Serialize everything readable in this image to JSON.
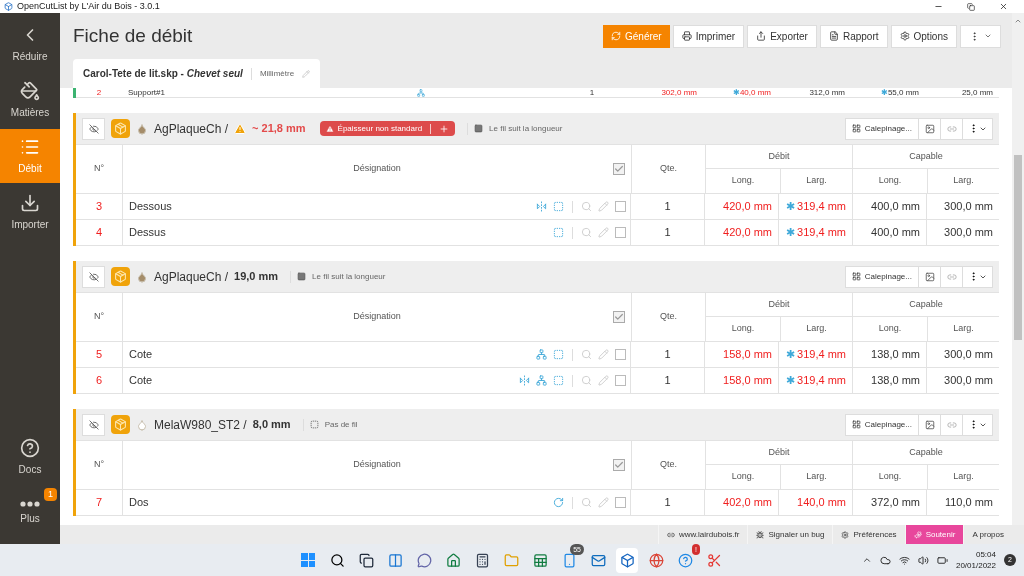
{
  "window": {
    "title": "OpenCutList by L'Air du Bois - 3.0.1"
  },
  "sidebar": {
    "items": [
      {
        "kind": "collapse",
        "label": "Réduire",
        "selected": false
      },
      {
        "kind": "materials",
        "label": "Matières",
        "selected": false
      },
      {
        "kind": "cutlist",
        "label": "Débit",
        "selected": true
      },
      {
        "kind": "import",
        "label": "Importer",
        "selected": false
      },
      {
        "kind": "docs",
        "label": "Docs",
        "selected": false
      },
      {
        "kind": "more",
        "label": "Plus",
        "selected": false,
        "badge": "1"
      }
    ]
  },
  "header": {
    "title": "Fiche de débit",
    "buttons": [
      {
        "kind": "generate",
        "label": "Générer",
        "primary": true
      },
      {
        "kind": "print",
        "label": "Imprimer",
        "primary": false
      },
      {
        "kind": "export",
        "label": "Exporter",
        "primary": false
      },
      {
        "kind": "report",
        "label": "Rapport",
        "primary": false
      },
      {
        "kind": "options",
        "label": "Options",
        "primary": false
      },
      {
        "kind": "menu",
        "primary": false
      }
    ]
  },
  "tab": {
    "file": "Carol-Tete de lit.skp - *Chevet seul*",
    "unit": "Millimètre"
  },
  "partial_row": {
    "color": "#3cb371",
    "number": "2",
    "name": "Support#1",
    "icons": [
      {
        "kind": "nodes"
      }
    ],
    "qty": "1",
    "cells": [
      {
        "text": "302,0 mm",
        "warn": true
      },
      {
        "mark": "✱",
        "text": "40,0 mm",
        "warn": true
      },
      {
        "text": "312,0 mm",
        "warn": false
      },
      {
        "mark": "✱",
        "text": "55,0 mm",
        "warn": false
      },
      {
        "text": "25,0 mm",
        "warn": false
      }
    ]
  },
  "groups": [
    {
      "color": "#f0a30a",
      "drop": {
        "color": "#a58d6a"
      },
      "material": "AgPlaqueCh /",
      "thickness": "~ 21,8 mm",
      "thickness_warning": true,
      "badge": "Épaisseur non standard",
      "grain": {
        "kind": "lengthwise",
        "label": "Le fil suit la longueur"
      },
      "layout_button": "Calepinage...",
      "columns": {
        "number": "N°",
        "designation": "Désignation",
        "qty": "Qte.",
        "debit": "Débit",
        "capable": "Capable",
        "debit_long": "Long.",
        "debit_larg": "Larg.",
        "capable_long": "Long.",
        "capable_larg": "Larg.",
        "all_checked": true
      },
      "rows": [
        {
          "number": "3",
          "name": "Dessous",
          "icons": [
            {
              "kind": "mirror"
            },
            {
              "kind": "edges"
            }
          ],
          "checked": false,
          "qty": "1",
          "cells": [
            {
              "text": "420,0 mm",
              "warn": true
            },
            {
              "mark": "✱",
              "text": "319,4 mm",
              "warn": true
            },
            {
              "text": "400,0 mm",
              "warn": false
            },
            {
              "text": "300,0 mm",
              "warn": false
            }
          ]
        },
        {
          "number": "4",
          "name": "Dessus",
          "icons": [
            {
              "kind": "edges"
            }
          ],
          "checked": false,
          "qty": "1",
          "cells": [
            {
              "text": "420,0 mm",
              "warn": true
            },
            {
              "mark": "✱",
              "text": "319,4 mm",
              "warn": true
            },
            {
              "text": "400,0 mm",
              "warn": false
            },
            {
              "text": "300,0 mm",
              "warn": false
            }
          ]
        }
      ]
    },
    {
      "color": "#f0a30a",
      "drop": {
        "color": "#a58d6a"
      },
      "material": "AgPlaqueCh /",
      "thickness": "19,0 mm",
      "thickness_warning": false,
      "grain": {
        "kind": "lengthwise",
        "label": "Le fil suit la longueur"
      },
      "layout_button": "Calepinage...",
      "columns": {
        "number": "N°",
        "designation": "Désignation",
        "qty": "Qte.",
        "debit": "Débit",
        "capable": "Capable",
        "debit_long": "Long.",
        "debit_larg": "Larg.",
        "capable_long": "Long.",
        "capable_larg": "Larg.",
        "all_checked": true
      },
      "rows": [
        {
          "number": "5",
          "name": "Cote",
          "icons": [
            {
              "kind": "nodes"
            },
            {
              "kind": "edges"
            }
          ],
          "checked": false,
          "qty": "1",
          "cells": [
            {
              "text": "158,0 mm",
              "warn": true
            },
            {
              "mark": "✱",
              "text": "319,4 mm",
              "warn": true
            },
            {
              "text": "138,0 mm",
              "warn": false
            },
            {
              "text": "300,0 mm",
              "warn": false
            }
          ]
        },
        {
          "number": "6",
          "name": "Cote",
          "icons": [
            {
              "kind": "mirror"
            },
            {
              "kind": "nodes"
            },
            {
              "kind": "edges"
            }
          ],
          "checked": false,
          "qty": "1",
          "cells": [
            {
              "text": "158,0 mm",
              "warn": true
            },
            {
              "mark": "✱",
              "text": "319,4 mm",
              "warn": true
            },
            {
              "text": "138,0 mm",
              "warn": false
            },
            {
              "text": "300,0 mm",
              "warn": false
            }
          ]
        }
      ]
    },
    {
      "color": "#f0a30a",
      "drop": {
        "color": "#ffffff"
      },
      "material": "MelaW980_ST2 /",
      "thickness": "8,0 mm",
      "thickness_warning": false,
      "grain": {
        "kind": "none",
        "label": "Pas de fil"
      },
      "layout_button": "Calepinage...",
      "columns": {
        "number": "N°",
        "designation": "Désignation",
        "qty": "Qte.",
        "debit": "Débit",
        "capable": "Capable",
        "debit_long": "Long.",
        "debit_larg": "Larg.",
        "capable_long": "Long.",
        "capable_larg": "Larg.",
        "all_checked": true
      },
      "rows": [
        {
          "number": "7",
          "name": "Dos",
          "icons": [
            {
              "kind": "rotate"
            }
          ],
          "checked": false,
          "qty": "1",
          "cells": [
            {
              "text": "402,0 mm",
              "warn": true
            },
            {
              "text": "140,0 mm",
              "warn": true
            },
            {
              "text": "372,0 mm",
              "warn": false
            },
            {
              "text": "110,0 mm",
              "warn": false
            }
          ]
        }
      ]
    }
  ],
  "status_bar": [
    {
      "kind": "link",
      "label": "www.lairdubois.fr",
      "highlight": false
    },
    {
      "kind": "bug",
      "label": "Signaler un bug",
      "highlight": false
    },
    {
      "kind": "prefs",
      "label": "Préférences",
      "highlight": false
    },
    {
      "kind": "support",
      "label": "Soutenir",
      "highlight": true
    },
    {
      "kind": "about",
      "label": "A propos",
      "highlight": false
    }
  ],
  "taskbar": {
    "apps": [
      {
        "kind": "start"
      },
      {
        "kind": "search"
      },
      {
        "kind": "tasks"
      },
      {
        "kind": "widgets"
      },
      {
        "kind": "chat"
      },
      {
        "kind": "home"
      },
      {
        "kind": "calculator"
      },
      {
        "kind": "folder"
      },
      {
        "kind": "excel"
      },
      {
        "kind": "phone",
        "badge": "55"
      },
      {
        "kind": "outlook"
      },
      {
        "kind": "sketchup",
        "selected": true
      },
      {
        "kind": "chrome"
      },
      {
        "kind": "help",
        "badge": "!"
      },
      {
        "kind": "snip"
      }
    ],
    "time": "05:04",
    "date": "20/01/2022",
    "notifications": "2"
  }
}
